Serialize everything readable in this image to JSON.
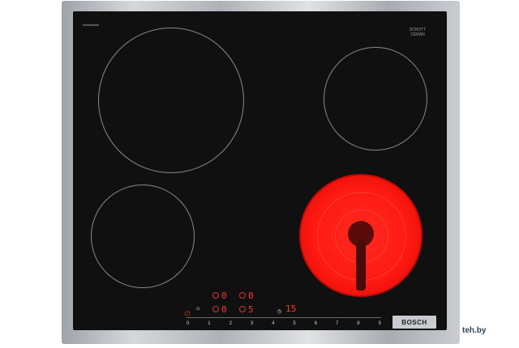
{
  "colors": {
    "glass": "#101010",
    "frame": "steel",
    "heat": "#ff1a12",
    "display": "#ff3b2f"
  },
  "display": {
    "left_top": "0",
    "right_top": "0",
    "left_bottom": "0",
    "right_bottom": "5",
    "timer": "15"
  },
  "controls": {
    "scale": [
      "0",
      "1",
      "2",
      "3",
      "4",
      "5",
      "6",
      "7",
      "8",
      "9"
    ]
  },
  "brand": {
    "label": "BOSCH",
    "glass_mark": "SCHOTT CERAN"
  },
  "watermark": "teh.by"
}
